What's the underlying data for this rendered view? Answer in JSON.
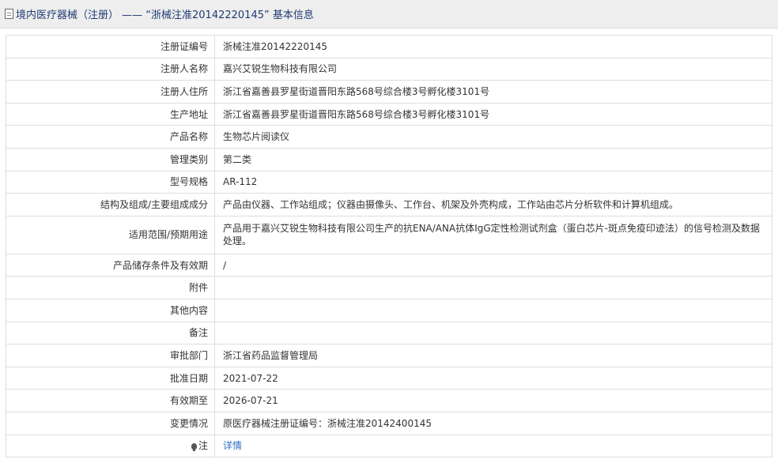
{
  "header": {
    "icon": "document-icon",
    "title": "境内医疗器械（注册） —— “浙械注准20142220145” 基本信息"
  },
  "rows": [
    {
      "label": "注册证编号",
      "value": "浙械注准20142220145"
    },
    {
      "label": "注册人名称",
      "value": "嘉兴艾锐生物科技有限公司"
    },
    {
      "label": "注册人住所",
      "value": "浙江省嘉善县罗星街道晋阳东路568号综合楼3号孵化楼3101号"
    },
    {
      "label": "生产地址",
      "value": "浙江省嘉善县罗星街道晋阳东路568号综合楼3号孵化楼3101号"
    },
    {
      "label": "产品名称",
      "value": "生物芯片阅读仪"
    },
    {
      "label": "管理类别",
      "value": "第二类"
    },
    {
      "label": "型号规格",
      "value": "AR-112"
    },
    {
      "label": "结构及组成/主要组成成分",
      "value": "产品由仪器、工作站组成；仪器由摄像头、工作台、机架及外壳构成，工作站由芯片分析软件和计算机组成。"
    },
    {
      "label": "适用范围/预期用途",
      "value": "产品用于嘉兴艾锐生物科技有限公司生产的抗ENA/ANA抗体IgG定性检测试剂盒（蛋白芯片-斑点免疫印迹法）的信号检测及数据处理。"
    },
    {
      "label": "产品储存条件及有效期",
      "value": "/"
    },
    {
      "label": "附件",
      "value": ""
    },
    {
      "label": "其他内容",
      "value": ""
    },
    {
      "label": "备注",
      "value": ""
    },
    {
      "label": "审批部门",
      "value": "浙江省药品监督管理局"
    },
    {
      "label": "批准日期",
      "value": "2021-07-22"
    },
    {
      "label": "有效期至",
      "value": "2026-07-21"
    },
    {
      "label": "变更情况",
      "value": "原医疗器械注册证编号：浙械注准20142400145"
    }
  ],
  "note": {
    "icon": "lightbulb-icon",
    "label": "注",
    "link_text": "详情"
  }
}
